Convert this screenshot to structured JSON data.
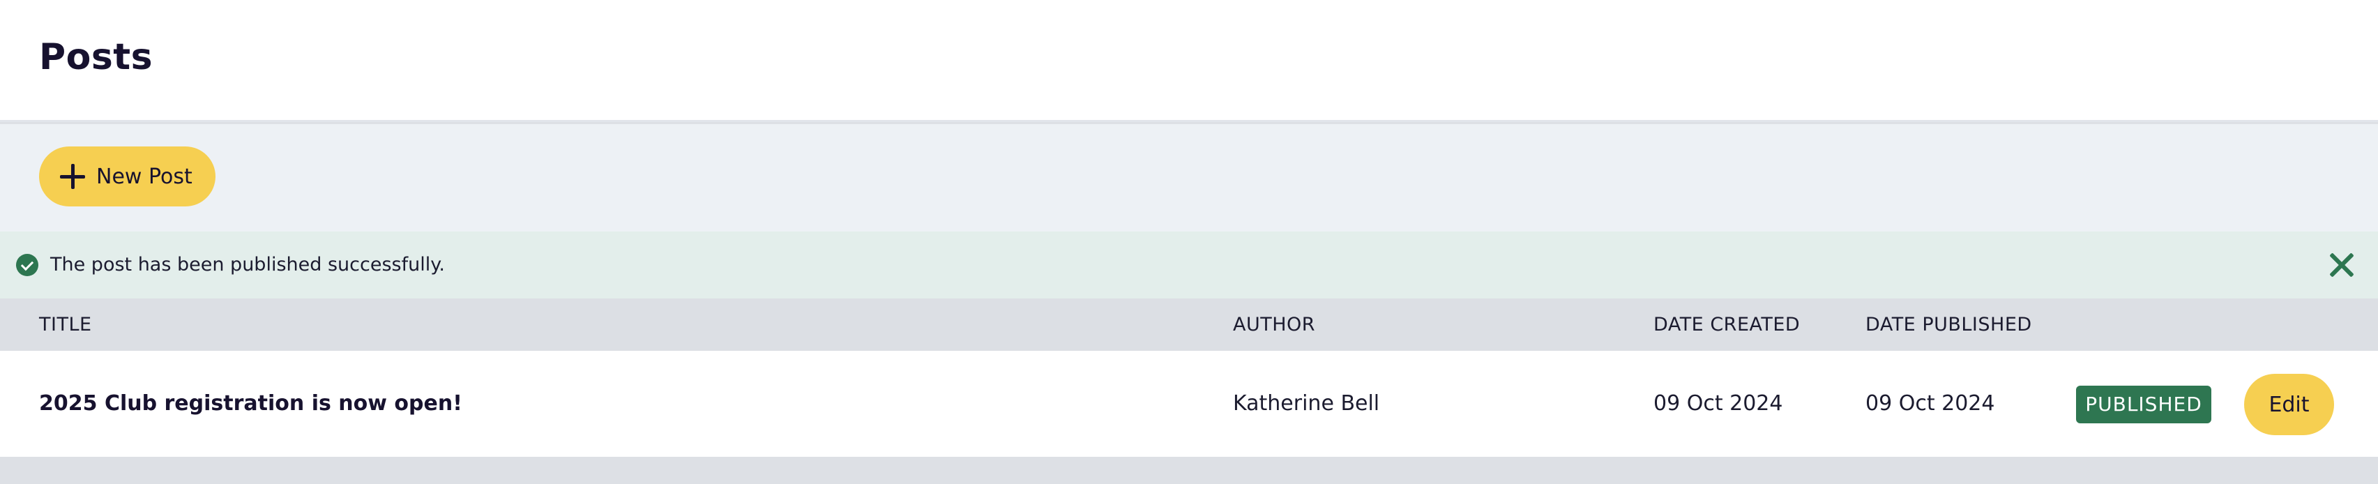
{
  "page": {
    "title": "Posts"
  },
  "toolbar": {
    "new_post_label": "New Post",
    "new_post_icon": "plus-icon"
  },
  "alert": {
    "message": "The post has been published successfully.",
    "status_icon": "check-circle-icon",
    "dismiss_icon": "close-icon"
  },
  "table": {
    "columns": [
      "TITLE",
      "AUTHOR",
      "DATE CREATED",
      "DATE PUBLISHED"
    ],
    "rows": [
      {
        "title": "2025 Club registration is now open!",
        "author": "Katherine Bell",
        "date_created": "09 Oct 2024",
        "date_published": "09 Oct 2024",
        "status": "PUBLISHED",
        "action_label": "Edit"
      }
    ]
  },
  "colors": {
    "accent_yellow": "#f6cf51",
    "success_green": "#2d7650",
    "toolbar_bg": "#edf1f5",
    "alert_bg": "#e3eeeb",
    "table_header_bg": "#dcdfe4"
  }
}
